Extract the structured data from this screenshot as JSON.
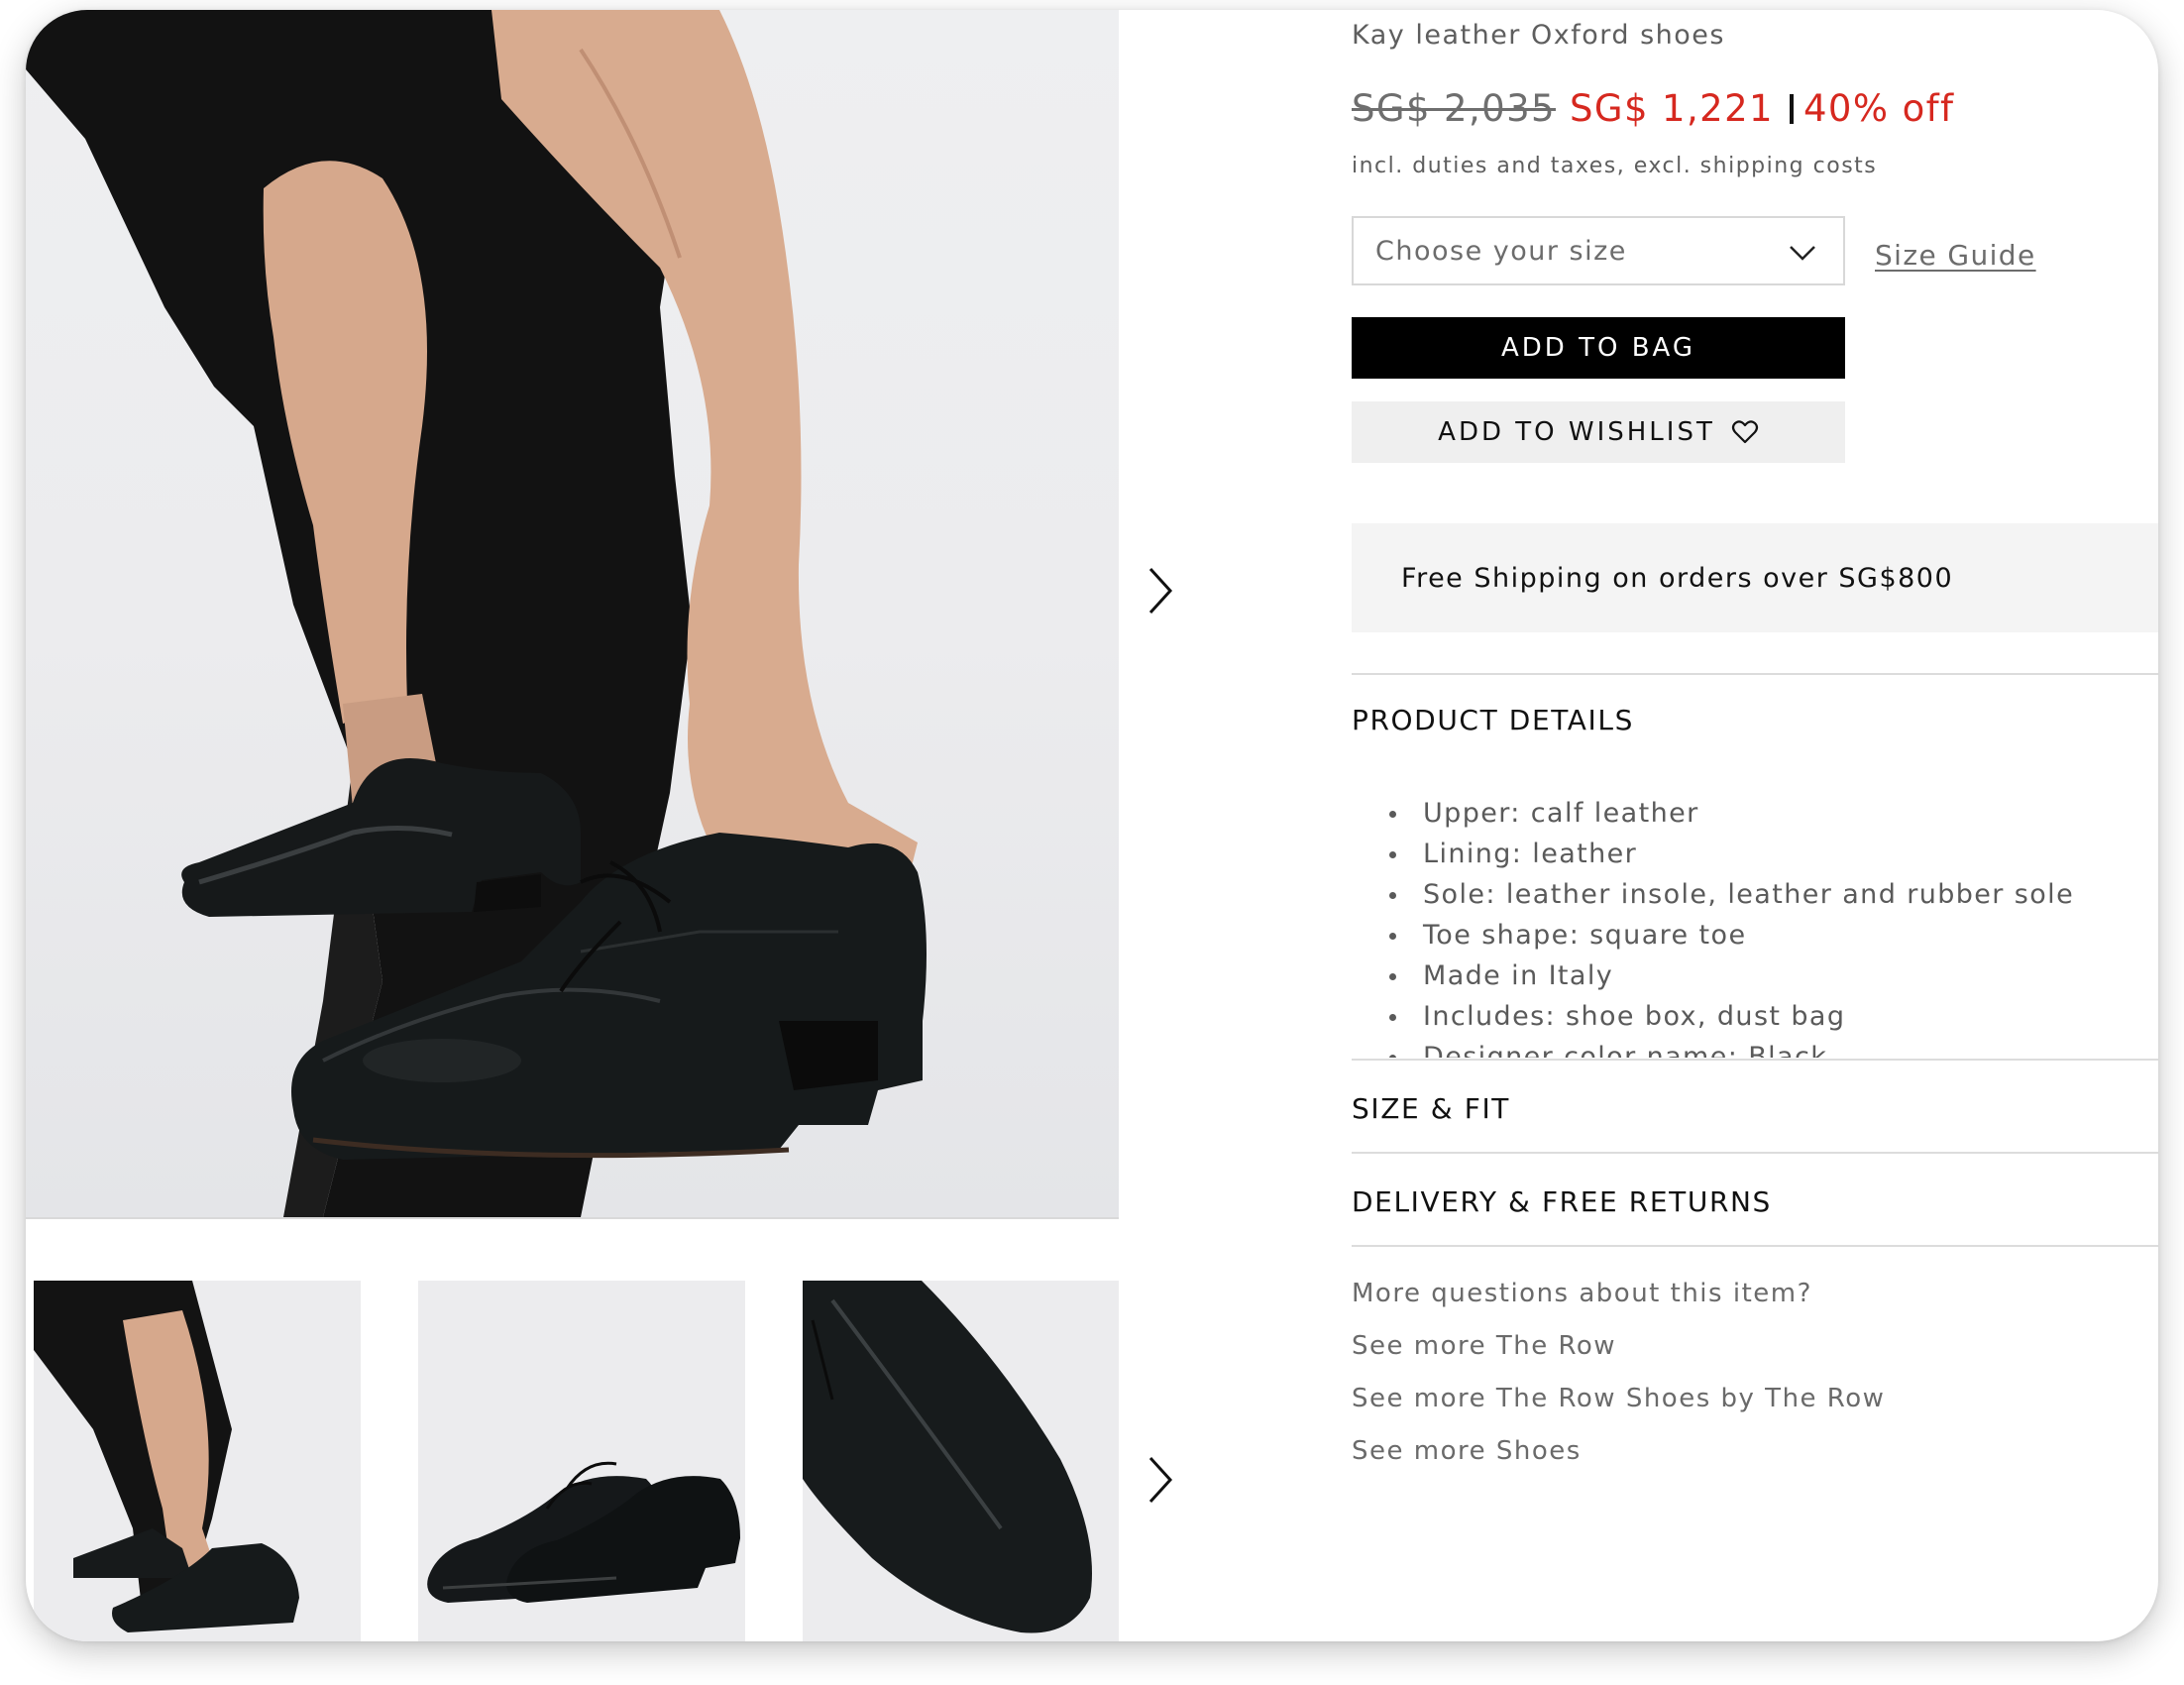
{
  "product": {
    "title": "Kay leather Oxford shoes",
    "price_original": "SG$ 2,035",
    "price_sale": "SG$ 1,221",
    "discount": "40% off",
    "tax_note": "incl. duties and taxes, excl. shipping costs"
  },
  "size": {
    "placeholder": "Choose your size",
    "guide_label": "Size Guide"
  },
  "actions": {
    "add_to_bag": "ADD TO BAG",
    "add_to_wishlist": "ADD TO WISHLIST"
  },
  "shipping_banner": "Free Shipping on orders over SG$800",
  "sections": {
    "details": "PRODUCT DETAILS",
    "size_fit": "SIZE & FIT",
    "delivery": "DELIVERY & FREE RETURNS"
  },
  "details_items": [
    "Upper: calf leather",
    "Lining: leather",
    "Sole: leather insole, leather and rubber sole",
    "Toe shape: square toe",
    "Made in Italy",
    "Includes: shoe box, dust bag",
    "Designer color name: Black"
  ],
  "more_links": [
    "More questions about this item?",
    "See more The Row",
    "See more The Row Shoes by The Row",
    "See more Shoes"
  ],
  "icons": {
    "next_main": "chevron-right-icon",
    "next_thumbs": "chevron-right-icon",
    "size_dropdown": "chevron-down-icon",
    "wishlist": "heart-outline-icon"
  },
  "colors": {
    "sale_red": "#d6281f",
    "text_gray": "#5e5e5e",
    "black": "#000000",
    "banner_bg": "#f4f4f4"
  }
}
